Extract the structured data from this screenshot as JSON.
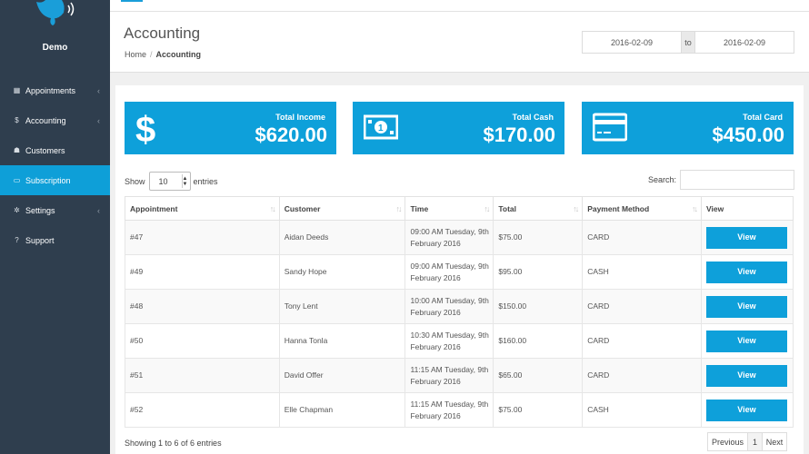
{
  "sidebar": {
    "user_name": "Demo",
    "items": [
      {
        "label": "Appointments",
        "icon": "calendar-icon",
        "glyph": "▦",
        "has_submenu": true,
        "active": false
      },
      {
        "label": "Accounting",
        "icon": "dollar-icon",
        "glyph": "$",
        "has_submenu": true,
        "active": false
      },
      {
        "label": "Customers",
        "icon": "users-icon",
        "glyph": "☗",
        "has_submenu": false,
        "active": false
      },
      {
        "label": "Subscription",
        "icon": "credit-card-icon",
        "glyph": "▭",
        "has_submenu": false,
        "active": true
      },
      {
        "label": "Settings",
        "icon": "gear-icon",
        "glyph": "✲",
        "has_submenu": true,
        "active": false
      },
      {
        "label": "Support",
        "icon": "question-icon",
        "glyph": "?",
        "has_submenu": false,
        "active": false
      }
    ],
    "chevron": "‹"
  },
  "header": {
    "title": "Accounting",
    "breadcrumb": {
      "home": "Home",
      "separator": "/",
      "current": "Accounting"
    },
    "date_range": {
      "from": "2016-02-09",
      "to_label": "to",
      "to": "2016-02-09"
    }
  },
  "stats": [
    {
      "label": "Total Income",
      "value": "$620.00",
      "icon": "dollar-icon"
    },
    {
      "label": "Total Cash",
      "value": "$170.00",
      "icon": "banknote-icon"
    },
    {
      "label": "Total Card",
      "value": "$450.00",
      "icon": "credit-card-icon"
    }
  ],
  "table_controls": {
    "show_label": "Show",
    "page_size": "10",
    "entries_label": "entries",
    "search_label": "Search:"
  },
  "table": {
    "columns": [
      "Appointment",
      "Customer",
      "Time",
      "Total",
      "Payment Method",
      "View"
    ],
    "rows": [
      {
        "appointment": "#47",
        "customer": "Aidan Deeds",
        "time_1": "09:00 AM Tuesday, 9th",
        "time_2": "February 2016",
        "total": "$75.00",
        "method": "CARD",
        "view": "View"
      },
      {
        "appointment": "#49",
        "customer": "Sandy Hope",
        "time_1": "09:00 AM Tuesday, 9th",
        "time_2": "February 2016",
        "total": "$95.00",
        "method": "CASH",
        "view": "View"
      },
      {
        "appointment": "#48",
        "customer": "Tony Lent",
        "time_1": "10:00 AM Tuesday, 9th",
        "time_2": "February 2016",
        "total": "$150.00",
        "method": "CARD",
        "view": "View"
      },
      {
        "appointment": "#50",
        "customer": "Hanna Tonla",
        "time_1": "10:30 AM Tuesday, 9th",
        "time_2": "February 2016",
        "total": "$160.00",
        "method": "CARD",
        "view": "View"
      },
      {
        "appointment": "#51",
        "customer": "David Offer",
        "time_1": "11:15 AM Tuesday, 9th",
        "time_2": "February 2016",
        "total": "$65.00",
        "method": "CARD",
        "view": "View"
      },
      {
        "appointment": "#52",
        "customer": "Elle Chapman",
        "time_1": "11:15 AM Tuesday, 9th",
        "time_2": "February 2016",
        "total": "$75.00",
        "method": "CASH",
        "view": "View"
      }
    ]
  },
  "footer": {
    "info": "Showing 1 to 6 of 6 entries",
    "prev": "Previous",
    "page": "1",
    "next": "Next"
  },
  "colors": {
    "accent": "#0ea0da",
    "sidebar": "#2f3e4e"
  }
}
